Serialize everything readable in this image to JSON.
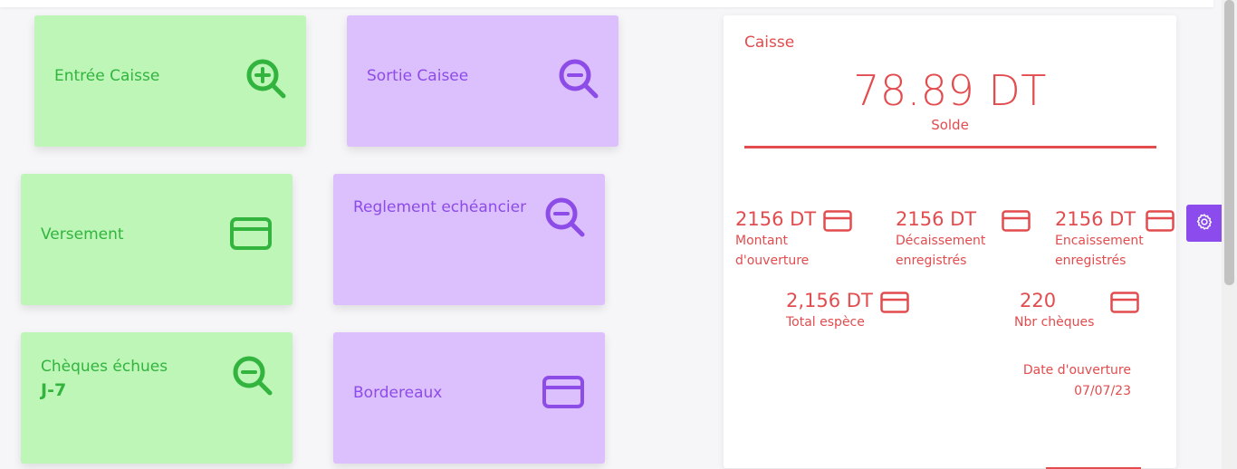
{
  "tiles": {
    "entree": {
      "label": "Entrée Caisse",
      "icon": "zoom-in-icon"
    },
    "sortie": {
      "label": "Sortie Caisee",
      "icon": "zoom-out-icon"
    },
    "versement": {
      "label": "Versement",
      "icon": "credit-card-icon"
    },
    "reglement": {
      "label": "Reglement echéancier",
      "icon": "zoom-out-icon"
    },
    "cheques": {
      "label": "Chèques échues",
      "sublabel": "J-7",
      "icon": "zoom-out-icon"
    },
    "bordereaux": {
      "label": "Bordereaux",
      "icon": "credit-card-icon"
    }
  },
  "caisse": {
    "title": "Caisse",
    "amount": "78.89 DT",
    "amount_label": "Solde",
    "stats": [
      {
        "value": "2156 DT",
        "label_line1": "Montant",
        "label_line2": "d'ouverture"
      },
      {
        "value": "2156 DT",
        "label_line1": "Décaissement",
        "label_line2": "enregistrés"
      },
      {
        "value": "2156 DT",
        "label_line1": "Encaissement",
        "label_line2": "enregistrés"
      },
      {
        "value": "2,156 DT",
        "label_line1": "Total espèce"
      },
      {
        "value": "220",
        "label_line1": "Nbr chèques"
      }
    ],
    "date_label": "Date d'ouverture",
    "date_value": "07/07/23"
  },
  "colors": {
    "green_tile": "#bdf6b7",
    "green_text": "#32b43f",
    "purple_tile": "#dcc0fe",
    "purple_text": "#8d4be8",
    "caisse_accent": "#e24c4e",
    "gear_button": "#8b4bed"
  },
  "settings": {
    "icon": "gear-icon"
  }
}
